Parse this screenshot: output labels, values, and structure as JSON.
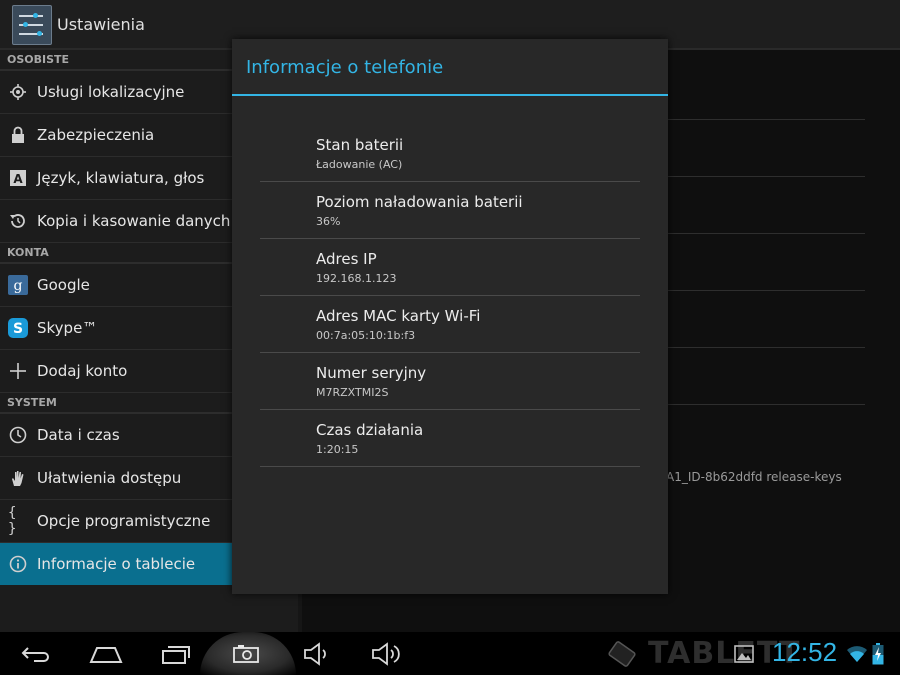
{
  "app": {
    "title": "Ustawienia"
  },
  "sidebar": {
    "sections": [
      {
        "label": "OSOBISTE",
        "items": [
          {
            "label": "Usługi lokalizacyjne",
            "icon": "location-icon"
          },
          {
            "label": "Zabezpieczenia",
            "icon": "lock-icon"
          },
          {
            "label": "Język, klawiatura, głos",
            "icon": "language-icon"
          },
          {
            "label": "Kopia i kasowanie danych",
            "icon": "backup-icon"
          }
        ]
      },
      {
        "label": "KONTA",
        "items": [
          {
            "label": "Google",
            "icon": "google-icon"
          },
          {
            "label": "Skype™",
            "icon": "skype-icon"
          },
          {
            "label": "Dodaj konto",
            "icon": "add-icon"
          }
        ]
      },
      {
        "label": "SYSTEM",
        "items": [
          {
            "label": "Data i czas",
            "icon": "clock-icon"
          },
          {
            "label": "Ułatwienia dostępu",
            "icon": "hand-icon"
          },
          {
            "label": "Opcje programistyczne",
            "icon": "braces-icon"
          },
          {
            "label": "Informacje o tablecie",
            "icon": "info-icon",
            "active": true
          }
        ]
      }
    ]
  },
  "background": {
    "build_text": "A1_ID-8b62ddfd release-keys"
  },
  "dialog": {
    "title": "Informacje o telefonie",
    "rows": [
      {
        "key": "Stan baterii",
        "value": "Ładowanie (AC)"
      },
      {
        "key": "Poziom naładowania baterii",
        "value": "36%"
      },
      {
        "key": "Adres IP",
        "value": "192.168.1.123"
      },
      {
        "key": "Adres MAC karty Wi-Fi",
        "value": "00:7a:05:10:1b:f3"
      },
      {
        "key": "Numer seryjny",
        "value": "M7RZXTMI2S"
      },
      {
        "key": "Czas działania",
        "value": "1:20:15"
      }
    ]
  },
  "statusbar": {
    "clock": "12:52",
    "watermark": "TABLETT"
  },
  "colors": {
    "accent": "#33b5e5",
    "active_item": "#0a6f8f"
  }
}
